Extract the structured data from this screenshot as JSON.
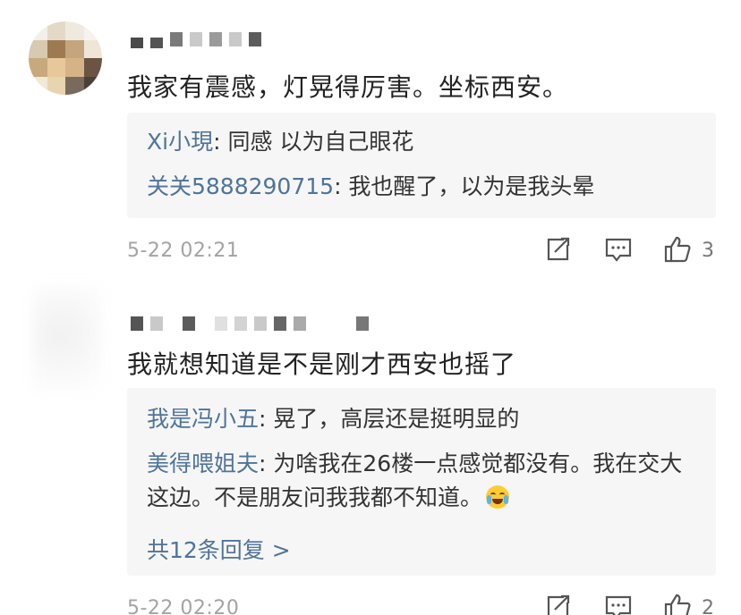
{
  "comments": [
    {
      "text": "我家有震感，灯晃得厉害。坐标西安。",
      "replies": [
        {
          "author": "Xi小現",
          "content": ": 同感 以为自己眼花"
        },
        {
          "author": "关关5888290715",
          "content": ": 我也醒了，以为是我头晕"
        }
      ],
      "timestamp": "5-22 02:21",
      "like_count": "3",
      "share_icon": "share-icon",
      "comment_icon": "comment-icon",
      "like_icon": "thumbs-up-icon"
    },
    {
      "text": "我就想知道是不是刚才西安也摇了",
      "replies": [
        {
          "author": "我是冯小五",
          "content": ": 晃了，高层还是挺明显的"
        },
        {
          "author": "美得喂姐夫",
          "content": ": 为啥我在26楼一点感觉都没有。我在交大这边。不是朋友问我我都不知道。"
        }
      ],
      "more_replies": "共12条回复 >",
      "timestamp": "5-22 02:20",
      "like_count": "2",
      "share_icon": "share-icon",
      "comment_icon": "comment-icon",
      "like_icon": "thumbs-up-icon"
    }
  ],
  "colors": {
    "author_link": "#4f7499",
    "comment_text": "#222222",
    "reply_bg": "#f6f6f6",
    "meta_text": "#a3a3a3",
    "icon_stroke": "#555555"
  }
}
